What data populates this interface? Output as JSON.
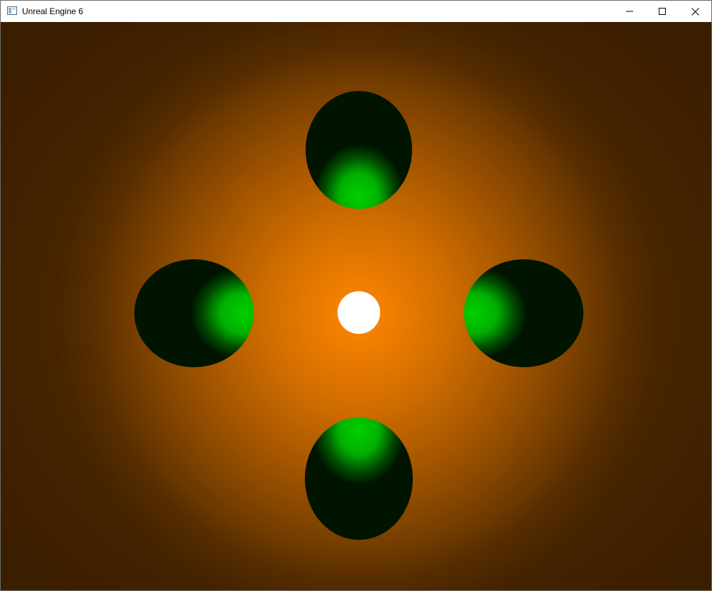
{
  "window": {
    "title": "Unreal Engine 6",
    "icons": {
      "app": "window-app-icon",
      "minimize": "minimize-icon",
      "maximize": "maximize-icon",
      "close": "close-icon"
    }
  },
  "scene": {
    "background_center_color": "#ff8a00",
    "background_edge_color": "#4a2600",
    "light_color": "#ffffff",
    "sphere_lit_color": "#00d000",
    "sphere_dark_color": "#001400",
    "spheres": [
      {
        "name": "top",
        "lit_side": "bottom"
      },
      {
        "name": "left",
        "lit_side": "right"
      },
      {
        "name": "right",
        "lit_side": "left"
      },
      {
        "name": "bottom",
        "lit_side": "top"
      }
    ]
  }
}
